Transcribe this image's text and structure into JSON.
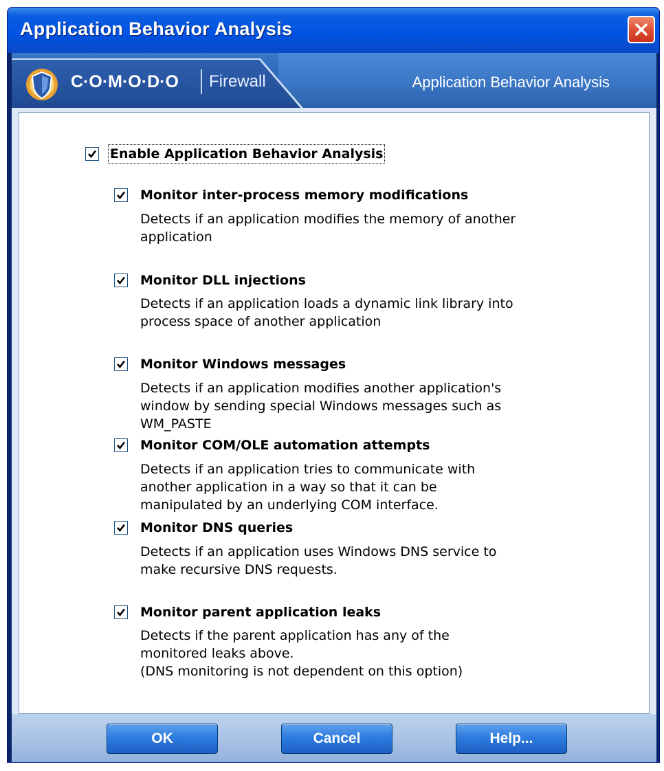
{
  "window": {
    "title": "Application Behavior Analysis",
    "close_icon": "close-icon"
  },
  "banner": {
    "logo_icon": "comodo-shield-icon",
    "brand": "C·O·M·O·D·O",
    "product": "Firewall",
    "title": "Application Behavior Analysis"
  },
  "main_option": {
    "label": "Enable Application Behavior Analysis",
    "checked": true
  },
  "options": [
    {
      "label": "Monitor inter-process memory modifications",
      "checked": true,
      "desc": [
        "Detects if an application modifies the memory of another",
        "application"
      ]
    },
    {
      "label": "Monitor DLL injections",
      "checked": true,
      "desc": [
        "Detects if an application loads a dynamic link library into",
        "process space of another application"
      ]
    },
    {
      "label": "Monitor Windows messages",
      "checked": true,
      "desc": [
        "Detects if an application modifies another application's",
        "window by sending special Windows messages such as",
        "WM_PASTE"
      ]
    },
    {
      "label": "Monitor COM/OLE automation attempts",
      "checked": true,
      "desc": [
        "Detects if an application tries to communicate with",
        "another application in a way so that it can be",
        "manipulated by an underlying COM interface."
      ]
    },
    {
      "label": "Monitor DNS queries",
      "checked": true,
      "desc": [
        "Detects if an application uses Windows DNS service to",
        "make recursive DNS requests."
      ]
    },
    {
      "label": "Monitor parent application leaks",
      "checked": true,
      "desc": [
        "Detects if the parent application has any of the",
        "monitored leaks above.",
        "(DNS monitoring is not dependent on this option)"
      ]
    }
  ],
  "buttons": {
    "ok": "OK",
    "cancel": "Cancel",
    "help": "Help..."
  },
  "colors": {
    "titlebar": "#0054e3",
    "banner": "#2a64b4",
    "frame": "#dfe8f6",
    "button": "#2e7ce0",
    "checkmark": "#000000"
  }
}
